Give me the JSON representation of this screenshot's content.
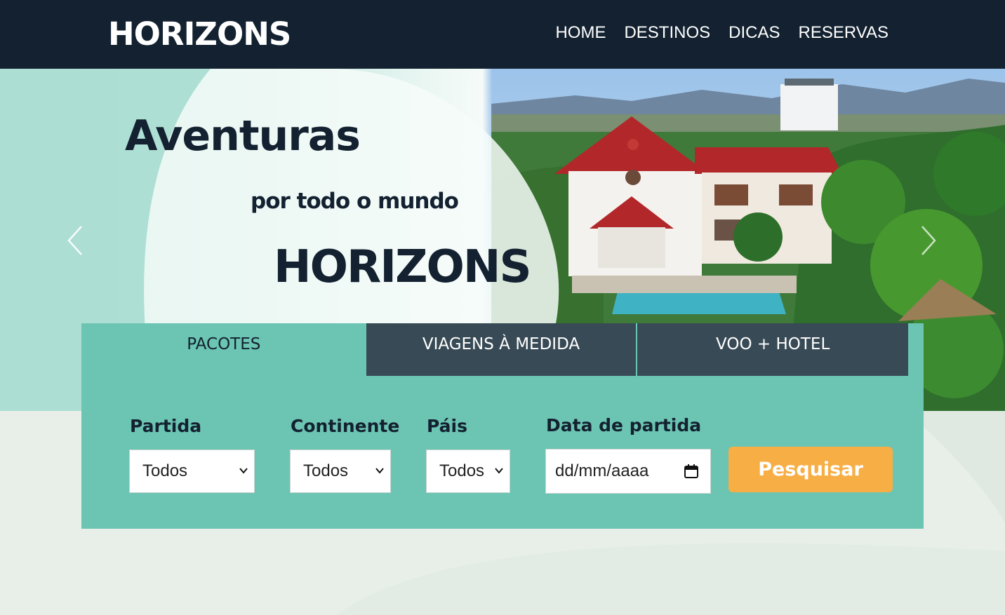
{
  "header": {
    "logo": "HORIZONS",
    "nav": [
      {
        "label": "HOME"
      },
      {
        "label": "DESTINOS"
      },
      {
        "label": "DICAS"
      },
      {
        "label": "RESERVAS"
      }
    ]
  },
  "hero": {
    "title": "Aventuras",
    "subtitle": "por todo o mundo",
    "brand": "HORIZONS",
    "prev_icon": "chevron-left-icon",
    "next_icon": "chevron-right-icon"
  },
  "search": {
    "tabs": [
      {
        "label": "PACOTES",
        "active": true
      },
      {
        "label": "VIAGENS À MEDIDA",
        "active": false
      },
      {
        "label": "VOO + HOTEL",
        "active": false
      }
    ],
    "fields": {
      "partida": {
        "label": "Partida",
        "value": "Todos"
      },
      "continente": {
        "label": "Continente",
        "value": "Todos"
      },
      "pais": {
        "label": "Páis",
        "value": "Todos"
      },
      "data": {
        "label": "Data de partida",
        "placeholder": "dd/mm/aaaa"
      }
    },
    "button": "Pesquisar"
  },
  "colors": {
    "header_bg": "#132130",
    "panel_bg": "#6cc4b2",
    "tab_dark": "#384a55",
    "button": "#f7ae45",
    "text_dark": "#132130"
  }
}
